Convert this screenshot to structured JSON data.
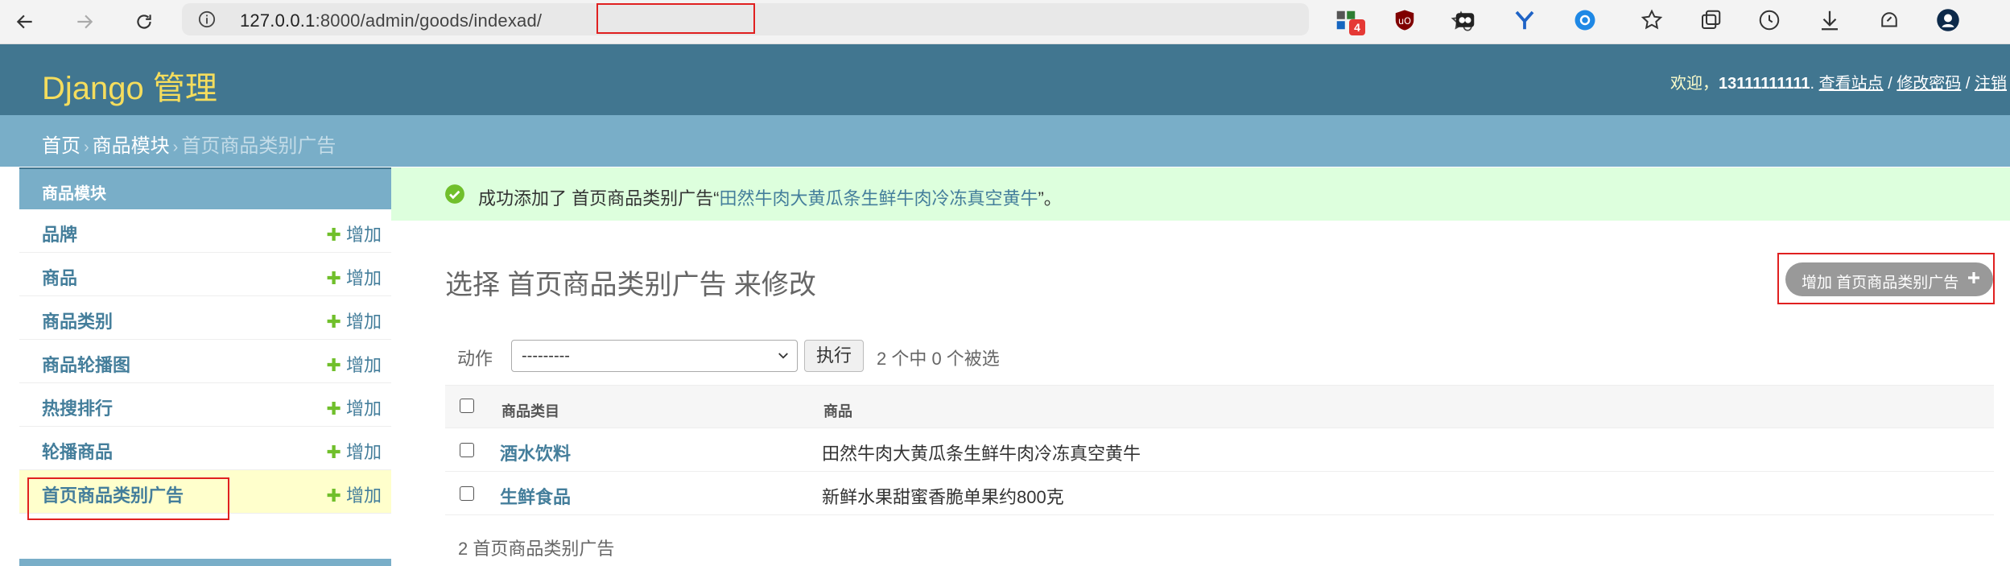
{
  "browser": {
    "url_host": "127.0.0.1",
    "url_port": ":8000/admin",
    "url_path": "/goods/indexad/",
    "extension_badge": "4"
  },
  "header": {
    "brand": "Django 管理",
    "welcome": "欢迎，",
    "username": "13111111111",
    "view_site": "查看站点",
    "change_password": "修改密码",
    "logout": "注销",
    "sep": "/",
    "dot": ".",
    "brand_color": "#f5dd5d",
    "bar_color": "#417690"
  },
  "breadcrumbs": {
    "home": "首页",
    "app": "商品模块",
    "current": "首页商品类别广告",
    "arrow": "›"
  },
  "sidebar": {
    "module": "商品模块",
    "add_label": "增加",
    "items": [
      {
        "label": "品牌"
      },
      {
        "label": "商品"
      },
      {
        "label": "商品类别"
      },
      {
        "label": "商品轮播图"
      },
      {
        "label": "热搜排行"
      },
      {
        "label": "轮播商品"
      },
      {
        "label": "首页商品类别广告"
      }
    ]
  },
  "message": {
    "prefix": "成功添加了 首页商品类别广告“",
    "link": "田然牛肉大黄瓜条生鲜牛肉冷冻真空黄牛",
    "suffix": "”。"
  },
  "main": {
    "title": "选择 首页商品类别广告 来修改",
    "add_button": "增加 首页商品类别广告"
  },
  "actions": {
    "label": "动作",
    "selected_option": "---------",
    "go_button": "执行",
    "counter": "2 个中 0 个被选"
  },
  "table": {
    "columns": [
      "商品类目",
      "商品"
    ],
    "rows": [
      {
        "category": "酒水饮料",
        "product": "田然牛肉大黄瓜条生鲜牛肉冷冻真空黄牛"
      },
      {
        "category": "生鲜食品",
        "product": "新鲜水果甜蜜香脆单果约800克"
      }
    ]
  },
  "paginator": "2 首页商品类别广告"
}
